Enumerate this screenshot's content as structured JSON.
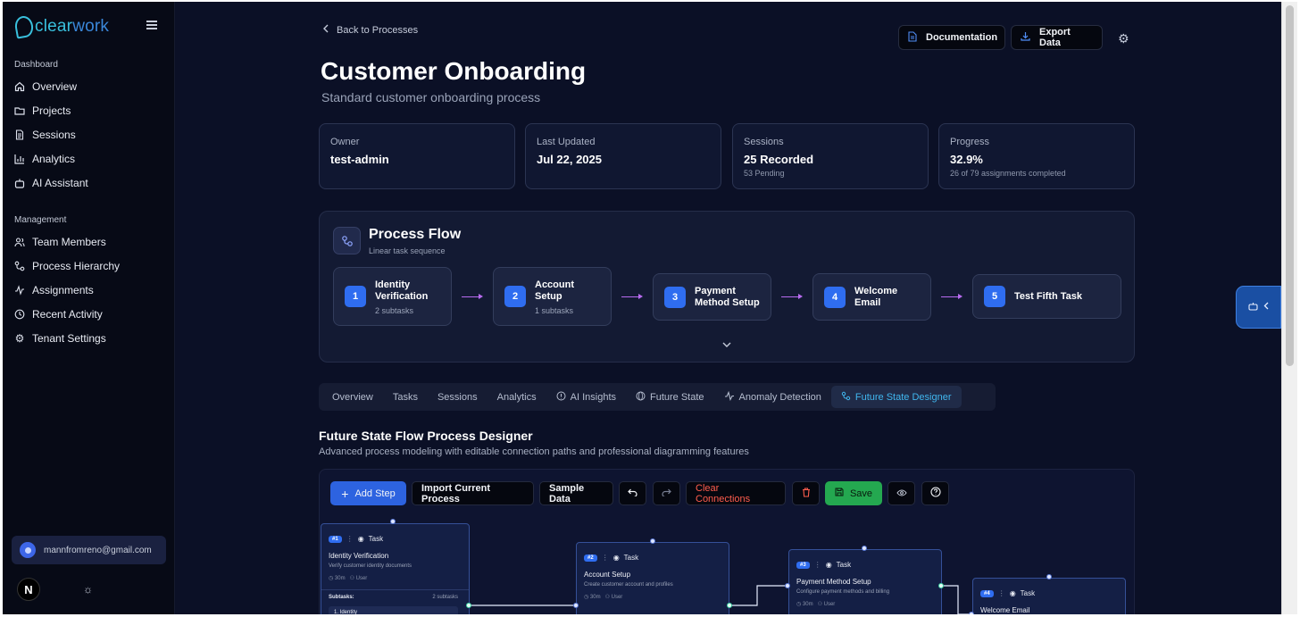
{
  "sidebar": {
    "logo": "clear",
    "logo_suffix": "work",
    "section_dashboard": "Dashboard",
    "dashboard_items": [
      "Overview",
      "Projects",
      "Sessions",
      "Analytics",
      "AI Assistant"
    ],
    "section_management": "Management",
    "management_items": [
      "Team Members",
      "Process Hierarchy",
      "Assignments",
      "Recent Activity",
      "Tenant Settings"
    ],
    "user_email": "mannfromreno@gmail.com",
    "badge": "N"
  },
  "header": {
    "back_label": "Back to Processes",
    "documentation_label": "Documentation",
    "export_label": "Export Data",
    "title": "Customer Onboarding",
    "subtitle": "Standard customer onboarding process"
  },
  "stats": [
    {
      "label": "Owner",
      "value": "test-admin",
      "sub": ""
    },
    {
      "label": "Last Updated",
      "value": "Jul 22, 2025",
      "sub": ""
    },
    {
      "label": "Sessions",
      "value": "25 Recorded",
      "sub": "53 Pending"
    },
    {
      "label": "Progress",
      "value": "32.9%",
      "sub": "26 of 79 assignments completed"
    }
  ],
  "process_flow": {
    "title": "Process Flow",
    "subtitle": "Linear task sequence",
    "steps": [
      {
        "num": "1",
        "line1": "Identity",
        "line2": "Verification",
        "subtasks": "2 subtasks"
      },
      {
        "num": "2",
        "line1": "Account",
        "line2": "Setup",
        "subtasks": "1 subtasks"
      },
      {
        "num": "3",
        "line1": "Payment",
        "line2": "Method Setup",
        "subtasks": ""
      },
      {
        "num": "4",
        "line1": "Welcome",
        "line2": "Email",
        "subtasks": ""
      },
      {
        "num": "5",
        "line1": "Test Fifth Task",
        "line2": "",
        "subtasks": ""
      }
    ]
  },
  "tabs": [
    "Overview",
    "Tasks",
    "Sessions",
    "Analytics",
    "AI Insights",
    "Future State",
    "Anomaly Detection",
    "Future State Designer"
  ],
  "active_tab": "Future State Designer",
  "designer": {
    "title": "Future State Flow Process Designer",
    "subtitle": "Advanced process modeling with editable connection paths and professional diagramming features",
    "toolbar": {
      "add_step": "Add Step",
      "import": "Import Current Process",
      "sample": "Sample Data",
      "clear": "Clear Connections",
      "save": "Save"
    },
    "nodes": [
      {
        "badge": "#1",
        "type": "Task",
        "title": "Identity Verification",
        "desc": "Verify customer identity documents",
        "duration": "30m",
        "role": "User",
        "subtasks_label": "Subtasks:",
        "subtasks_count": "2 subtasks",
        "first_subtask": "1. Identity"
      },
      {
        "badge": "#2",
        "type": "Task",
        "title": "Account Setup",
        "desc": "Create customer account and profiles",
        "duration": "30m",
        "role": "User"
      },
      {
        "badge": "#3",
        "type": "Task",
        "title": "Payment Method Setup",
        "desc": "Configure payment methods and billing",
        "duration": "30m",
        "role": "User"
      },
      {
        "badge": "#4",
        "type": "Task",
        "title": "Welcome Email",
        "desc": "",
        "duration": "",
        "role": ""
      }
    ]
  },
  "colors": {
    "background": "#0b1026",
    "accent": "#2f6df0",
    "active_tab": "#40b6ee",
    "save": "#24a850",
    "clear": "#ff5d4d"
  }
}
